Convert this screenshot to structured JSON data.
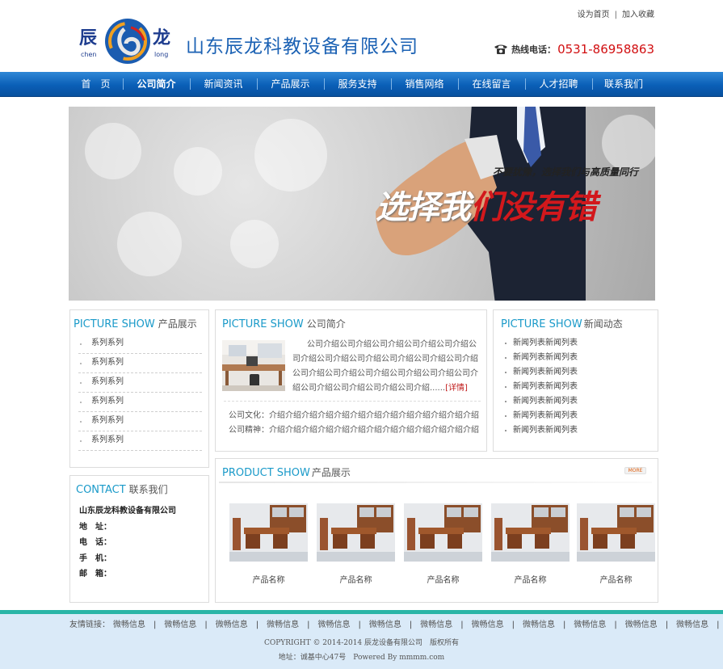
{
  "top_links": {
    "home": "设为首页",
    "separator": "|",
    "favorite": "加入收藏"
  },
  "header": {
    "logo_text_cn_left": "辰",
    "logo_text_cn_right": "龙",
    "logo_text_en_left": "chen",
    "logo_text_en_right": "long",
    "company_name": "山东辰龙科教设备有限公司",
    "hotline_label": "热线电话：",
    "hotline_number": "0531-86958863"
  },
  "nav": {
    "items": [
      "首　页",
      "公司简介",
      "新闻资讯",
      "产品展示",
      "服务支持",
      "销售网络",
      "在线留言",
      "人才招聘",
      "联系我们"
    ],
    "active_index": 1
  },
  "banner": {
    "slogan_small": "不要犹豫，选择我们与高质量同行",
    "slogan_big_part1": "选择我",
    "slogan_big_part2": "们没有错"
  },
  "left_products": {
    "title_en": "PICTURE SHOW",
    "title_cn": "产品展示",
    "items": [
      "系列系列",
      "系列系列",
      "系列系列",
      "系列系列",
      "系列系列",
      "系列系列"
    ]
  },
  "contact": {
    "title_en": "CONTACT",
    "title_cn": "联系我们",
    "company": "山东辰龙科教设备有限公司",
    "address_label": "地　址：",
    "phone_label": "电　话：",
    "mobile_label": "手　机：",
    "email_label": "邮　箱："
  },
  "about": {
    "title_en": "PICTURE SHOW",
    "title_cn": "公司简介",
    "text": "公司介绍公司介绍公司介绍公司介绍公司介绍公司介绍公司介绍公司介绍公司介绍公司介绍公司介绍公司介绍公司介绍公司介绍公司介绍公司介绍公司介绍公司介绍公司介绍公司介绍公司介绍......",
    "more": "[详情]",
    "culture_label": "公司文化：",
    "culture_text": "介绍介绍介绍介绍介绍介绍介绍介绍介绍介绍介绍介绍介绍",
    "spirit_label": "公司精神：",
    "spirit_text": "介绍介绍介绍介绍介绍介绍介绍介绍介绍介绍介绍介绍介绍"
  },
  "news": {
    "title_en": "PICTURE SHOW",
    "title_cn": "新闻动态",
    "items": [
      "新闻列表新闻列表",
      "新闻列表新闻列表",
      "新闻列表新闻列表",
      "新闻列表新闻列表",
      "新闻列表新闻列表",
      "新闻列表新闻列表",
      "新闻列表新闻列表"
    ]
  },
  "products": {
    "title_en": "PRODUCT SHOW",
    "title_cn": "产品展示",
    "more": "MORE",
    "items": [
      "产品名称",
      "产品名称",
      "产品名称",
      "产品名称",
      "产品名称"
    ]
  },
  "footer": {
    "friend_label": "友情链接：",
    "links": [
      "微畅信息",
      "微畅信息",
      "微畅信息",
      "微畅信息",
      "微畅信息",
      "微畅信息",
      "微畅信息",
      "微畅信息",
      "微畅信息",
      "微畅信息",
      "微畅信息",
      "微畅信息",
      "微畅信息"
    ],
    "separator": "|",
    "copyright": "COPYRIGHT © 2014-2014 辰龙设备有限公司　版权所有",
    "address": "地址：诚基中心47号　Powered By mmmm.com"
  },
  "colors": {
    "brand_blue": "#1c62b4",
    "accent_cyan": "#1a9ac9",
    "hotline_red": "#d10e10",
    "footer_bg": "#daeaf8",
    "footer_strip": "#2ab5a7"
  }
}
